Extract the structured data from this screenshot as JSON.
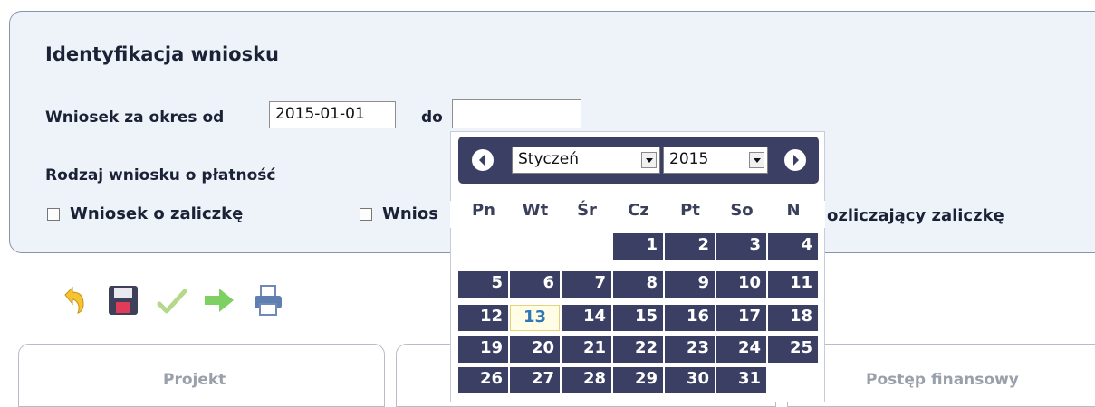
{
  "form": {
    "title": "Identyfikacja wniosku",
    "period_label": "Wniosek za okres od",
    "date_from": "2015-01-01",
    "to_label": "do",
    "date_to": "",
    "type_label": "Rodzaj wniosku o płatność",
    "option1": "Wniosek o zaliczkę",
    "option2_visible": "Wnios",
    "option3_visible": "ozliczający zaliczkę"
  },
  "calendar": {
    "month": "Styczeń",
    "year": "2015",
    "weekdays": [
      "Pn",
      "Wt",
      "Śr",
      "Cz",
      "Pt",
      "So",
      "N"
    ],
    "today": "13",
    "days": [
      "1",
      "2",
      "3",
      "4",
      "5",
      "6",
      "7",
      "8",
      "9",
      "10",
      "11",
      "12",
      "13",
      "14",
      "15",
      "16",
      "17",
      "18",
      "19",
      "20",
      "21",
      "22",
      "23",
      "24",
      "25",
      "26",
      "27",
      "28",
      "29",
      "30",
      "31"
    ]
  },
  "tabs": {
    "tab1": "Projekt",
    "tab3": "Postęp finansowy"
  },
  "toolbar": {
    "icons": [
      "undo-icon",
      "save-icon",
      "check-icon",
      "forward-arrow-icon",
      "print-icon"
    ]
  }
}
